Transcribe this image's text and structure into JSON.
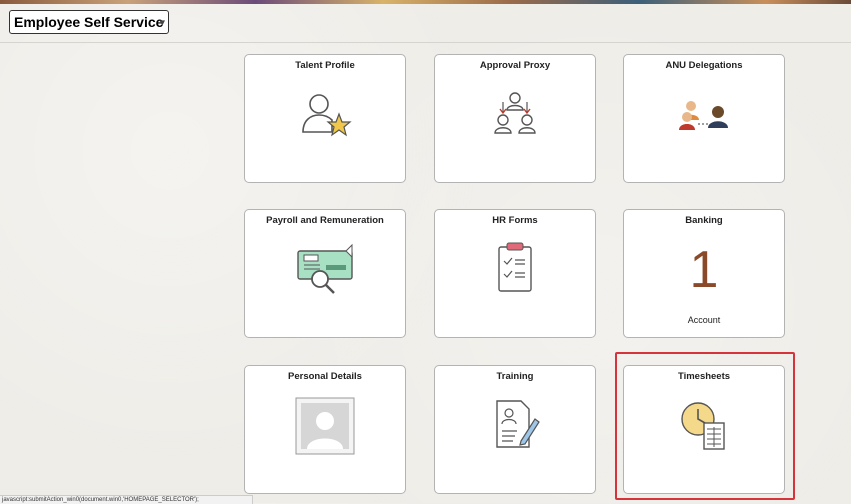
{
  "header": {
    "title": "Employee Self Service",
    "dropdown_icon": "chevron-down-icon"
  },
  "tiles": [
    {
      "label": "Talent Profile",
      "icon": "person-star-icon"
    },
    {
      "label": "Approval Proxy",
      "icon": "approval-proxy-icon"
    },
    {
      "label": "ANU Delegations",
      "icon": "delegation-people-icon"
    },
    {
      "label": "Payroll and Remuneration",
      "icon": "cheque-magnifier-icon"
    },
    {
      "label": "HR Forms",
      "icon": "clipboard-checklist-icon"
    },
    {
      "label": "Banking",
      "value": "1",
      "sublabel": "Account"
    },
    {
      "label": "Personal Details",
      "icon": "profile-photo-placeholder-icon"
    },
    {
      "label": "Training",
      "icon": "document-pencil-icon"
    },
    {
      "label": "Timesheets",
      "icon": "clock-timesheet-icon"
    }
  ],
  "status_bar": {
    "text": "javascript:submitAction_win0(document.win0,'HOMEPAGE_SELECTOR');"
  },
  "colors": {
    "highlight": "#d6343b",
    "tile_border": "#b3b3b3",
    "banking_number": "#8a4a2a"
  }
}
